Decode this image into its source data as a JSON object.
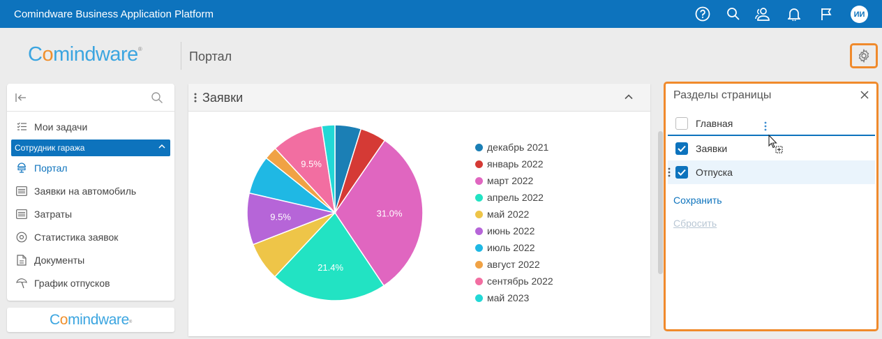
{
  "topbar": {
    "title": "Comindware Business Application Platform",
    "icons": [
      "help-icon",
      "search-icon",
      "users-icon",
      "bell-icon",
      "flag-icon"
    ],
    "avatar_initials": "ИИ"
  },
  "header": {
    "logo_text": "Comindware",
    "page_title": "Портал"
  },
  "sidebar": {
    "items": [
      {
        "label": "Мои задачи",
        "icon": "tasks-icon"
      },
      {
        "label": "Портал",
        "icon": "portal-icon"
      },
      {
        "label": "Заявки на автомобиль",
        "icon": "list-icon"
      },
      {
        "label": "Затраты",
        "icon": "list-icon"
      },
      {
        "label": "Статистика заявок",
        "icon": "stats-icon"
      },
      {
        "label": "Документы",
        "icon": "document-icon"
      },
      {
        "label": "График отпусков",
        "icon": "vacation-icon"
      }
    ],
    "group_label": "Сотрудник гаража",
    "footer_logo": "Comindware"
  },
  "widget": {
    "title": "Заявки"
  },
  "chart_data": {
    "type": "pie",
    "categories": [
      "декабрь 2021",
      "январь 2022",
      "март 2022",
      "апрель 2022",
      "май 2022",
      "июнь 2022",
      "июль 2022",
      "август 2022",
      "сентябрь 2022",
      "май 2023"
    ],
    "values": [
      4.8,
      4.8,
      31.0,
      21.4,
      7.1,
      9.5,
      7.1,
      2.4,
      9.5,
      2.4
    ],
    "colors": [
      "#1b7fb5",
      "#d53a35",
      "#e066c0",
      "#22e3c3",
      "#eec548",
      "#b665d8",
      "#1fb8e4",
      "#f0a245",
      "#f26ea1",
      "#22d8d6"
    ],
    "data_labels": [
      "",
      "",
      "31.0%",
      "21.4%",
      "",
      "9.5%",
      "",
      "",
      "9.5%",
      ""
    ],
    "legend_position": "right"
  },
  "sections_panel": {
    "title": "Разделы страницы",
    "items": [
      {
        "label": "Главная",
        "checked": false
      },
      {
        "label": "Заявки",
        "checked": true
      },
      {
        "label": "Отпуска",
        "checked": true
      }
    ],
    "save_label": "Сохранить",
    "reset_label": "Сбросить"
  }
}
